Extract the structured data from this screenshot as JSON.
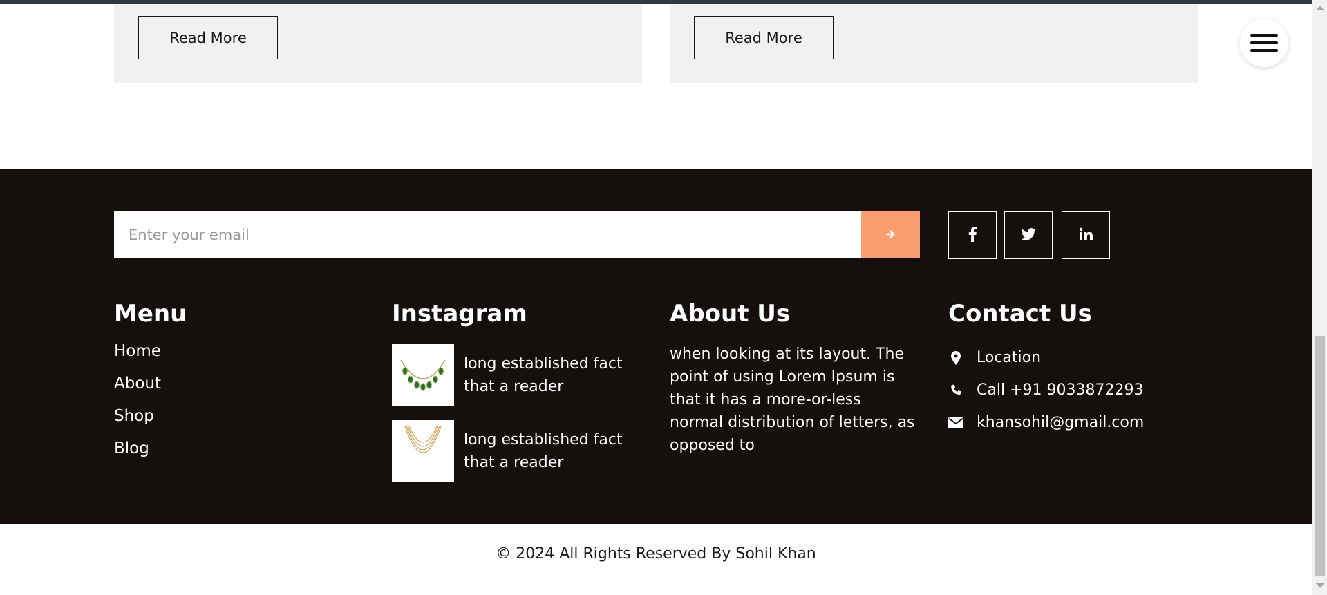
{
  "cards": [
    {
      "button_label": "Read More"
    },
    {
      "button_label": "Read More"
    }
  ],
  "footer": {
    "newsletter": {
      "placeholder": "Enter your email",
      "submit_icon": "arrow-right-icon",
      "accent_color": "#fb9e6f"
    },
    "social": [
      {
        "name": "facebook",
        "icon": "facebook-icon"
      },
      {
        "name": "twitter",
        "icon": "twitter-icon"
      },
      {
        "name": "linkedin",
        "icon": "linkedin-icon"
      }
    ],
    "menu": {
      "title": "Menu",
      "links": [
        "Home",
        "About",
        "Shop",
        "Blog"
      ]
    },
    "instagram": {
      "title": "Instagram",
      "items": [
        {
          "text": "long established fact that a reader",
          "image": "emerald-necklace"
        },
        {
          "text": "long established fact that a reader",
          "image": "gold-layered-necklace"
        }
      ]
    },
    "about": {
      "title": "About Us",
      "text": "when looking at its layout. The point of using Lorem Ipsum is that it has a more-or-less normal distribution of letters, as opposed to"
    },
    "contact": {
      "title": "Contact Us",
      "items": [
        {
          "icon": "location-pin-icon",
          "text": "Location"
        },
        {
          "icon": "phone-icon",
          "text": "Call +91 9033872293"
        },
        {
          "icon": "envelope-icon",
          "text": "khansohil@gmail.com"
        }
      ]
    },
    "background_color": "#15100e"
  },
  "copyright": "© 2024 All Rights Reserved By Sohil Khan"
}
